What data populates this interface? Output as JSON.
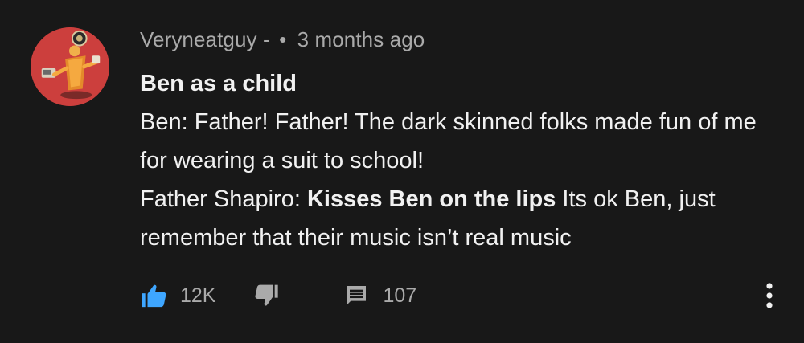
{
  "comment": {
    "author": "Veryneatguy -",
    "separator": "•",
    "timestamp": "3 months ago",
    "title": "Ben as a child",
    "line1": "Ben: Father! Father! The dark skinned folks made fun of me for wearing a suit to school!",
    "line2_prefix": "Father Shapiro: ",
    "line2_bold": "Kisses Ben on the lips",
    "line2_suffix": " Its ok Ben, just remember that their music isn’t real music"
  },
  "actions": {
    "like_count": "12K",
    "reply_count": "107"
  },
  "icons": {
    "like": "thumbs-up-icon",
    "dislike": "thumbs-down-icon",
    "reply": "comment-icon",
    "more": "more-vertical-icon"
  },
  "colors": {
    "background": "#181818",
    "like_active": "#3ea6ff",
    "secondary_text": "#aaaaaa",
    "primary_text": "#f1f1f1",
    "avatar_bg": "#c73a3a"
  }
}
